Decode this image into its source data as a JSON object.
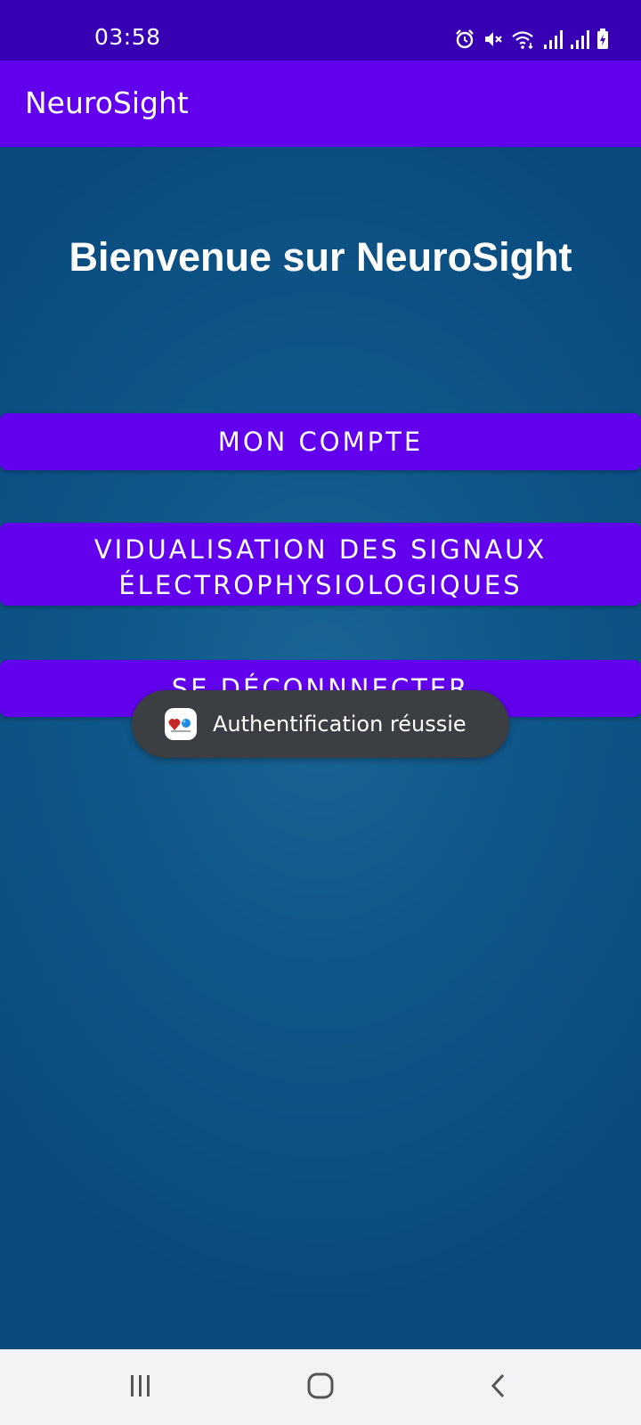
{
  "status_bar": {
    "time": "03:58",
    "icons": [
      "alarm-icon",
      "mute-icon",
      "wifi-icon",
      "signal-icon",
      "signal-icon",
      "battery-icon"
    ]
  },
  "app_bar": {
    "title": "NeuroSight"
  },
  "main": {
    "welcome": "Bienvenue sur NeuroSight",
    "buttons": {
      "account": "MON COMPTE",
      "signals_line1": "VIDUALISATION DES SIGNAUX",
      "signals_line2": "ÉLECTROPHYSIOLOGIQUES",
      "logout": "SE DÉCONNNECTER"
    }
  },
  "toast": {
    "message": "Authentification réussie",
    "icon": "app-logo-icon"
  },
  "nav_bar": {
    "icons": [
      "recents-icon",
      "home-icon",
      "back-icon"
    ]
  },
  "colors": {
    "status_bar": "#3700b3",
    "primary": "#6200ee",
    "background": "#0c4f82",
    "toast": "#3b3e42",
    "nav_bar": "#f3f3f5"
  }
}
